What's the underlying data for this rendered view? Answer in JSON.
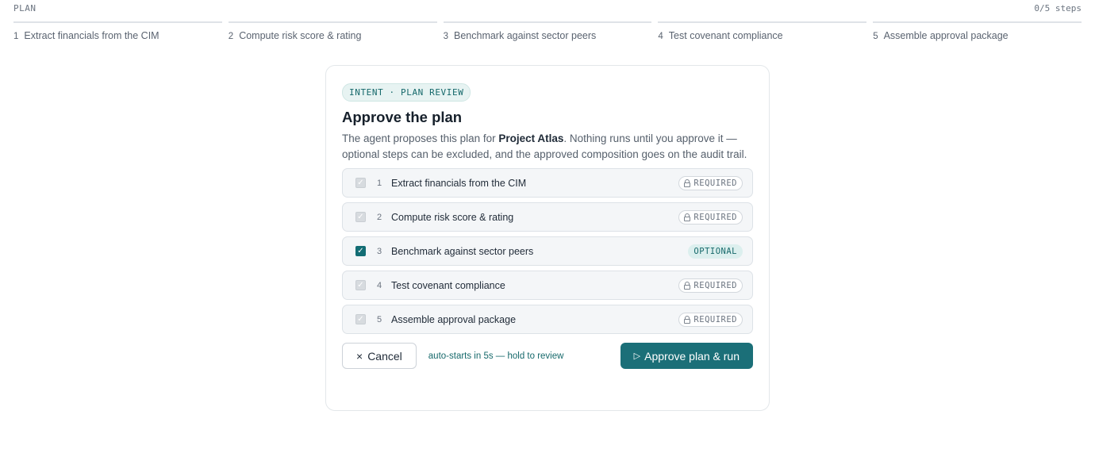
{
  "header": {
    "plan_label": "PLAN",
    "step_count": "0/5 steps"
  },
  "stepper": [
    {
      "num": "1",
      "label": "Extract financials from the CIM"
    },
    {
      "num": "2",
      "label": "Compute risk score & rating"
    },
    {
      "num": "3",
      "label": "Benchmark against sector peers"
    },
    {
      "num": "4",
      "label": "Test covenant compliance"
    },
    {
      "num": "5",
      "label": "Assemble approval package"
    }
  ],
  "card": {
    "tag": "INTENT · PLAN REVIEW",
    "title": "Approve the plan",
    "desc_before": "The agent proposes this plan for ",
    "project_name": "Project Atlas",
    "desc_after": ". Nothing runs until you approve it — optional steps can be excluded, and the approved composition goes on the audit trail."
  },
  "steps": [
    {
      "num": "1",
      "label": "Extract financials from the CIM",
      "badge": "REQUIRED",
      "optional": false,
      "checked": true
    },
    {
      "num": "2",
      "label": "Compute risk score & rating",
      "badge": "REQUIRED",
      "optional": false,
      "checked": true
    },
    {
      "num": "3",
      "label": "Benchmark against sector peers",
      "badge": "OPTIONAL",
      "optional": true,
      "checked": true
    },
    {
      "num": "4",
      "label": "Test covenant compliance",
      "badge": "REQUIRED",
      "optional": false,
      "checked": true
    },
    {
      "num": "5",
      "label": "Assemble approval package",
      "badge": "REQUIRED",
      "optional": false,
      "checked": true
    }
  ],
  "footer": {
    "cancel_icon": "×",
    "cancel_label": "Cancel",
    "auto_note": "auto-starts in 5s — hold to review",
    "approve_icon": "▷",
    "approve_label": "Approve plan & run"
  },
  "colors": {
    "accent": "#1b6f78",
    "accent_text": "#16696b",
    "tag_bg": "#e7f3f2"
  }
}
